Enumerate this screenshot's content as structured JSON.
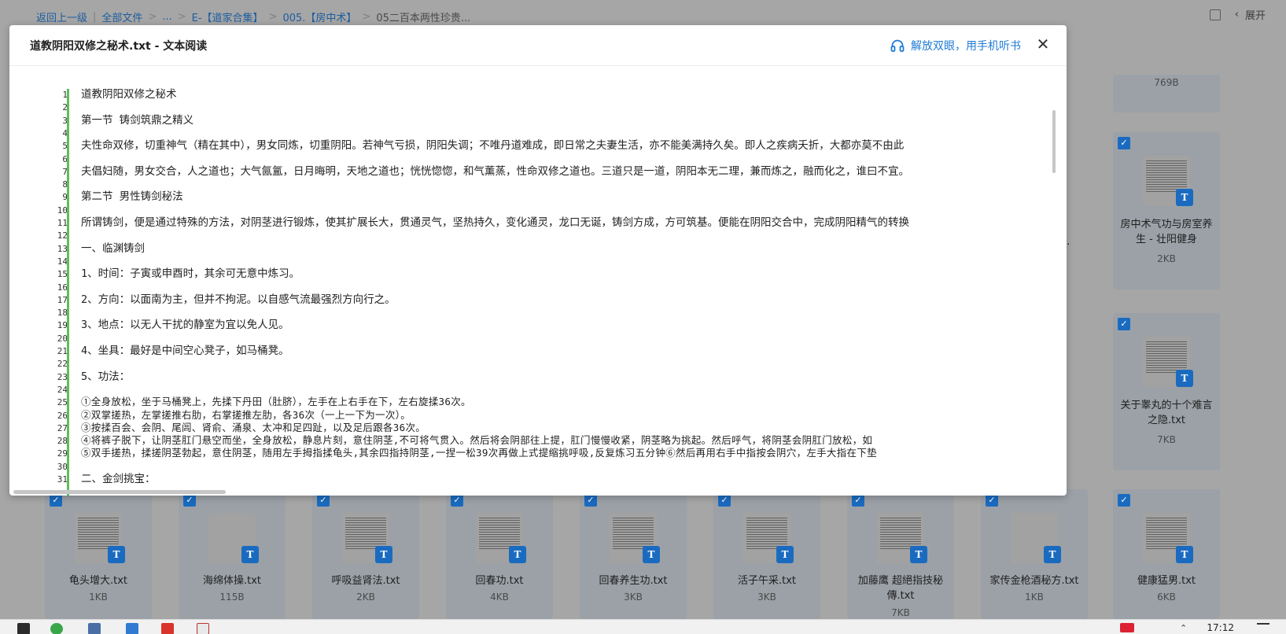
{
  "breadcrumb": {
    "back": "返回上一级",
    "all_files": "全部文件",
    "ellipsis": "...",
    "folder1": "E-【道家合集】",
    "folder2": "005.【房中术】",
    "current": "05二百本两性珍贵..."
  },
  "topbar": {
    "expand_label": "展开"
  },
  "files": [
    {
      "name": "",
      "size": "769B"
    },
    {
      "name": "房中术气功与房室养生 - 壮阳健身",
      "size": "2KB"
    },
    {
      "name": "关于睾丸的十个难言之隐.txt",
      "size": "7KB"
    },
    {
      "name": "龟头增大.txt",
      "size": "1KB"
    },
    {
      "name": "海绵体操.txt",
      "size": "115B"
    },
    {
      "name": "呼吸益肾法.txt",
      "size": "2KB"
    },
    {
      "name": "回春功.txt",
      "size": "4KB"
    },
    {
      "name": "回春养生功.txt",
      "size": "3KB"
    },
    {
      "name": "活子午采.txt",
      "size": "3KB"
    },
    {
      "name": "加藤鹰 超絕指技秘傳.txt",
      "size": "7KB"
    },
    {
      "name": "家传金枪酒秘方.txt",
      "size": "1KB"
    },
    {
      "name": "健康猛男.txt",
      "size": "6KB"
    }
  ],
  "partial_labels": {
    "row1_fragment": "...",
    "row2_fragment": "t",
    "row1_right_fragment": "室"
  },
  "modal": {
    "title": "道教阴阳双修之秘术.txt - 文本阅读",
    "listen_label": "解放双眼，用手机听书",
    "close_icon": "close-icon"
  },
  "lines": [
    "道教阴阳双修之秘术",
    "",
    "第一节 铸剑筑鼎之精义",
    "",
    "夫性命双修，切重神气（精在其中），男女同炼，切重阴阳。若神气亏损，阴阳失调；不唯丹道难成，即日常之夫妻生活，亦不能美满持久矣。即人之疾病夭折，大都亦莫不由此",
    "",
    "夫倡妇随，男女交合，人之道也；大气氤氲，日月晦明，天地之道也；恍恍惚惚，和气薰蒸，性命双修之道也。三道只是一道，阴阳本无二理，兼而炼之，融而化之，谁曰不宜。",
    "",
    "第二节 男性铸剑秘法",
    "",
    "所谓铸剑，便是通过特殊的方法，对阴茎进行锻炼，使其扩展长大，贯通灵气，坚热持久，变化通灵，龙口无诞，铸剑方成，方可筑基。便能在阴阳交合中，完成阴阳精气的转换",
    "",
    "一、临渊铸剑",
    "",
    "1、时间：子寅或申酉时，其余可无意中炼习。",
    "",
    "2、方向：以面南为主，但并不拘泥。以自感气流最强烈方向行之。",
    "",
    "3、地点：以无人干扰的静室为宜以免人见。",
    "",
    "4、坐具：最好是中间空心凳子，如马桶凳。",
    "",
    "5、功法：",
    "",
    "①全身放松，坐于马桶凳上，先揉下丹田（肚脐），左手在上右手在下，左右旋揉36次。",
    "②双掌搓热，左掌搓推右肋，右掌搓推左肋，各36次（一上一下为一次）。",
    "③按揉百会、会阴、尾闾、肾俞、涌泉、太冲和足四趾，以及足后跟各36次。",
    "④将裤子脱下，让阴茎肛门悬空而坐，全身放松，静息片刻，意住阴茎,不可将气贯入。然后将会阴部往上提，肛门慢慢收紧，阴茎略为挑起。然后呼气，将阴茎会阴肛门放松，如",
    "⑤双手搓热，揉搓阴茎勃起，意住阴茎，随用左手拇指揉龟头,其余四指持阴茎,一捏一松39次再做上式提缩挑呼吸,反复炼习五分钟⑥然后再用右手中指按会阴穴，左手大指在下垫",
    "",
    "二、金剑挑宝："
  ],
  "taskbar": {
    "clock": "17:12"
  }
}
